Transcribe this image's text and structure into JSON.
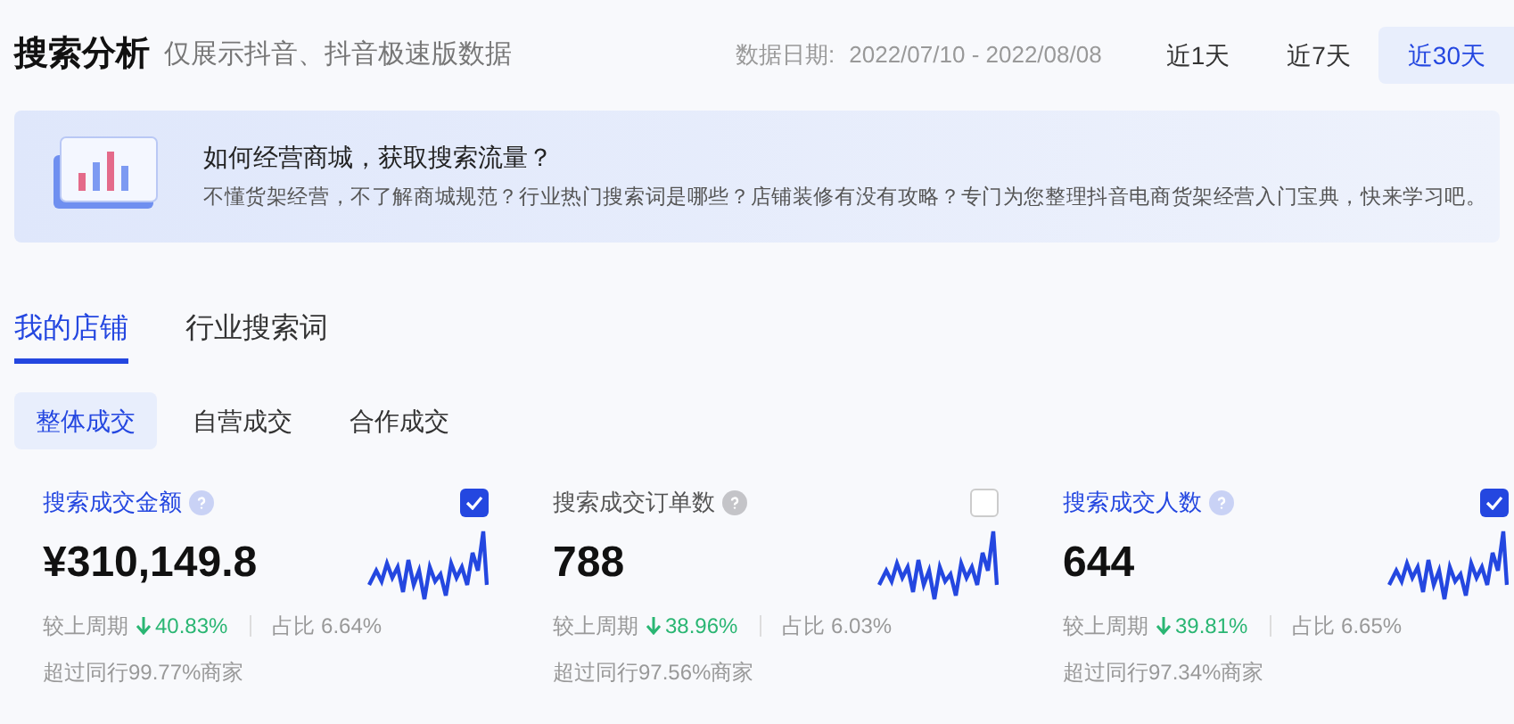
{
  "header": {
    "title": "搜索分析",
    "subtitle": "仅展示抖音、抖音极速版数据",
    "date_label": "数据日期:",
    "date_range": "2022/07/10 - 2022/08/08",
    "ranges": [
      {
        "label": "近1天",
        "selected": false
      },
      {
        "label": "近7天",
        "selected": false
      },
      {
        "label": "近30天",
        "selected": true
      }
    ]
  },
  "banner": {
    "title": "如何经营商城，获取搜索流量？",
    "text": "不懂货架经营，不了解商城规范？行业热门搜索词是哪些？店铺装修有没有攻略？专门为您整理抖音电商货架经营入门宝典，快来学习吧。"
  },
  "tabs": [
    {
      "label": "我的店铺",
      "selected": true
    },
    {
      "label": "行业搜索词",
      "selected": false
    }
  ],
  "subtabs": [
    {
      "label": "整体成交",
      "selected": true
    },
    {
      "label": "自营成交",
      "selected": false
    },
    {
      "label": "合作成交",
      "selected": false
    }
  ],
  "metrics": [
    {
      "title": "搜索成交金额",
      "checked": true,
      "value": "¥310,149.8",
      "compare_label": "较上周期",
      "change": "40.83%",
      "share": "占比 6.64%",
      "rank": "超过同行99.77%商家"
    },
    {
      "title": "搜索成交订单数",
      "checked": false,
      "value": "788",
      "compare_label": "较上周期",
      "change": "38.96%",
      "share": "占比 6.03%",
      "rank": "超过同行97.56%商家"
    },
    {
      "title": "搜索成交人数",
      "checked": true,
      "value": "644",
      "compare_label": "较上周期",
      "change": "39.81%",
      "share": "占比 6.65%",
      "rank": "超过同行97.34%商家"
    }
  ]
}
